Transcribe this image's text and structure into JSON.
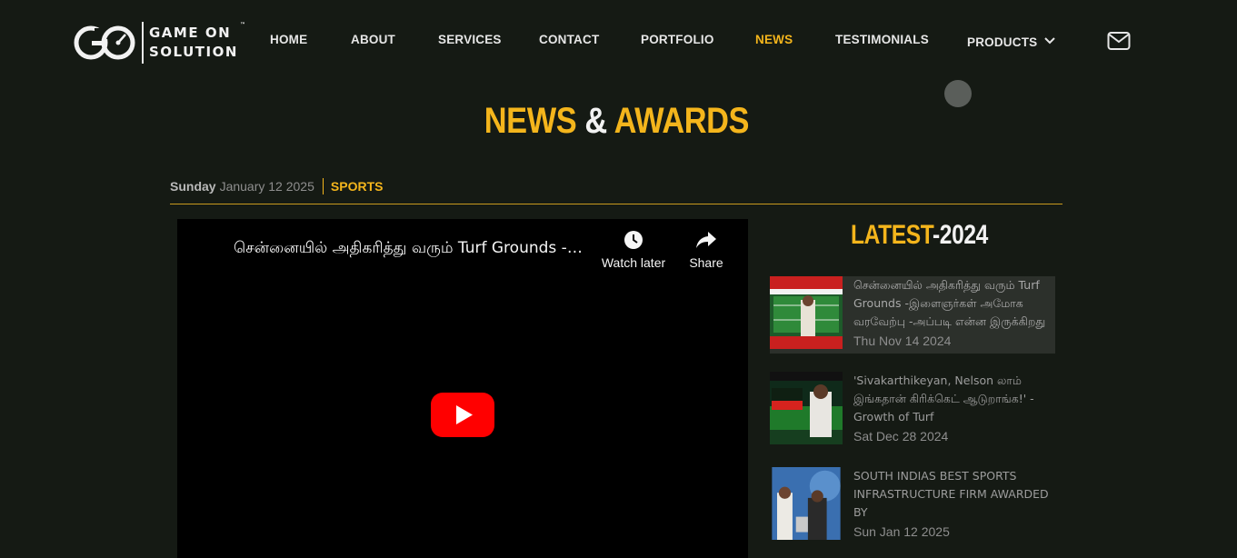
{
  "brand": {
    "word1": "GAME ON",
    "word2": "SOLUTION",
    "tm": "™"
  },
  "nav": {
    "items": [
      {
        "label": "HOME"
      },
      {
        "label": "ABOUT"
      },
      {
        "label": "SERVICES"
      },
      {
        "label": "CONTACT"
      },
      {
        "label": "PORTFOLIO"
      },
      {
        "label": "NEWS",
        "active": true
      },
      {
        "label": "TESTIMONIALS"
      },
      {
        "label": "PRODUCTS",
        "has_dropdown": true
      }
    ],
    "mail_icon": "envelope-icon"
  },
  "page": {
    "title_part1": "NEWS",
    "title_amp": "&",
    "title_part2": "AWARDS"
  },
  "article": {
    "day": "Sunday",
    "date": "January 12 2025",
    "category": "SPORTS"
  },
  "video": {
    "title": "சென்னையில் அதிகரித்து வரும் Turf Grounds -இளைஞர்கள் அமோக வரவேற்பு",
    "watch_later": "Watch later",
    "share": "Share"
  },
  "sidebar": {
    "heading_part1": "LATEST",
    "heading_part2": "-2024",
    "items": [
      {
        "title": "சென்னையில் அதிகரித்து வரும் Turf Grounds -இளைஞர்கள் அமோக வரவேற்பு -அப்படி என்ன இருக்கிறது இதில்",
        "date": "Thu Nov 14 2024"
      },
      {
        "title": "'Sivakarthikeyan, Nelson லாம் இங்கதான் கிரிக்கெட் ஆடுறாங்க!' - Growth of Turf",
        "date": "Sat Dec 28 2024"
      },
      {
        "title": "SOUTH INDIAS BEST SPORTS INFRASTRUCTURE FIRM AWARDED BY",
        "date": "Sun Jan 12 2025"
      }
    ]
  },
  "colors": {
    "background": "#151a14",
    "accent": "#f4b51c",
    "text": "#e6e6e6"
  }
}
